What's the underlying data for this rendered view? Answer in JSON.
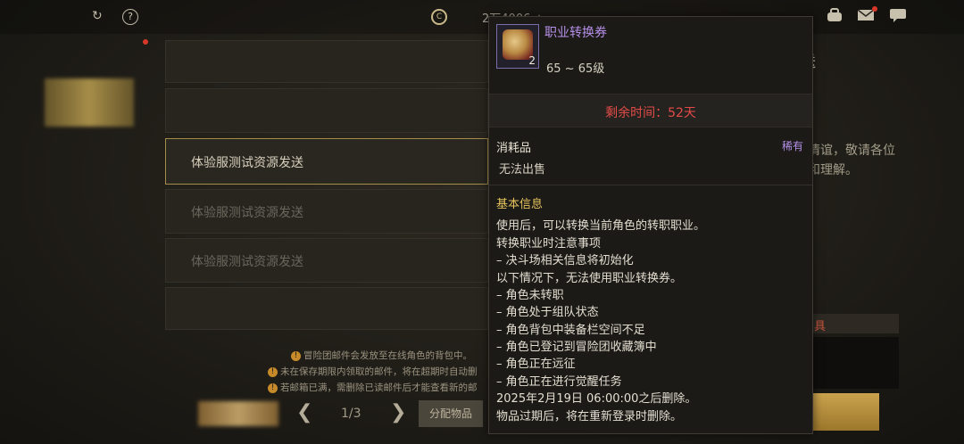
{
  "topbar": {
    "help_glyph": "?",
    "currency_value": "2万4006 +",
    "icons": [
      "refresh-icon",
      "help-icon",
      "coin-icon",
      "backpack-icon",
      "mail-icon",
      "chat-icon"
    ]
  },
  "mail_list": {
    "items": [
      {
        "label": "",
        "state": "blurred"
      },
      {
        "label": "",
        "state": "blurred"
      },
      {
        "label": "体验服测试资源发送",
        "state": "selected"
      },
      {
        "label": "体验服测试资源发送",
        "state": "faded"
      },
      {
        "label": "体验服测试资源发送",
        "state": "faded"
      },
      {
        "label": "",
        "state": "empty"
      }
    ],
    "notes": [
      "冒险团邮件会发放至在线角色的背包中。",
      "未在保存期限内领取的邮件，将在超期时自动删",
      "若邮箱已满，需删除已读邮件后才能查看新的邮"
    ]
  },
  "pagination": {
    "page_text": "1/3",
    "allocate_label": "分配物品"
  },
  "right_panel": {
    "title_fragment": "发送",
    "text_line1": "情谊，敬请各位",
    "text_line2": "和理解。",
    "red_fragment": "具"
  },
  "tooltip": {
    "item_name": "职业转换券",
    "item_count": "2",
    "level_range": "65 ~ 65级",
    "remaining_time": "剩余时间：52天",
    "category": "消耗品",
    "rarity": "稀有",
    "sell_status": "无法出售",
    "section_title": "基本信息",
    "description": [
      "使用后，可以转换当前角色的转职职业。",
      "转换职业时注意事项",
      "– 决斗场相关信息将初始化",
      "以下情况下，无法使用职业转换券。",
      "– 角色未转职",
      "– 角色处于组队状态",
      "– 角色背包中装备栏空间不足",
      "– 角色已登记到冒险团收藏簿中",
      "– 角色正在远征",
      "– 角色正在进行觉醒任务",
      "2025年2月19日 06:00:00之后删除。",
      "物品过期后，将在重新登录时删除。"
    ]
  },
  "colors": {
    "rarity_purple": "#b690e8",
    "time_red": "#e34b48",
    "section_gold": "#e6c35c"
  }
}
